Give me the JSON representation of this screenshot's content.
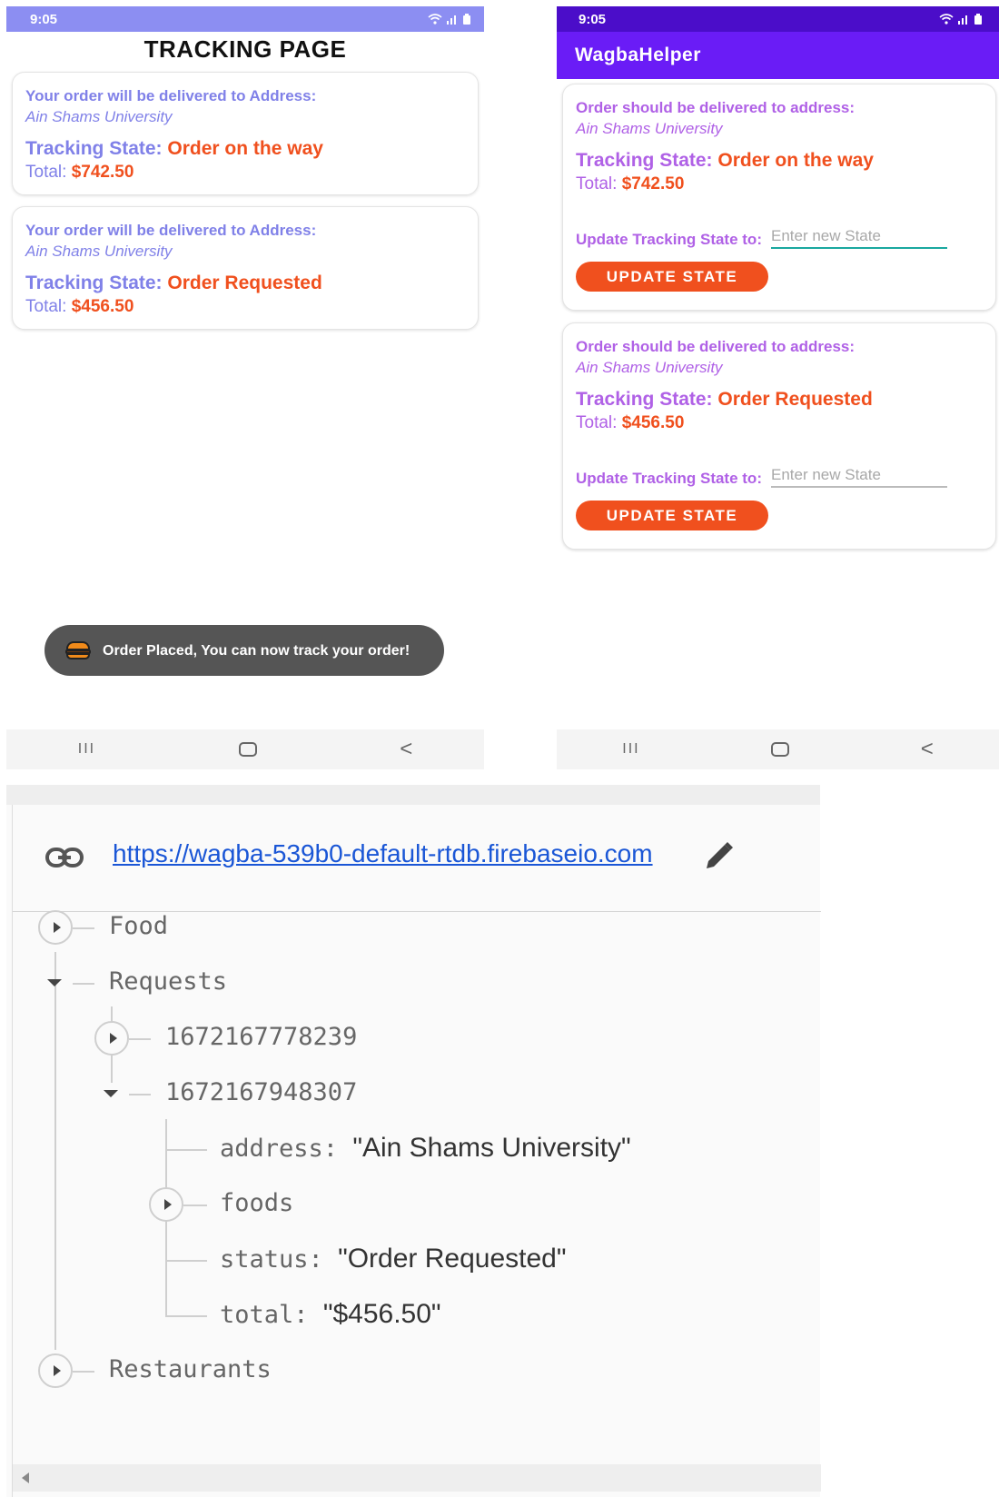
{
  "left_phone": {
    "status_time": "9:05",
    "status_icons": "wifi signal battery",
    "page_title": "TRACKING PAGE",
    "orders": [
      {
        "address_label": "Your order will be delivered to Address:",
        "address_value": "Ain Shams University",
        "state_label": "Tracking State:",
        "state_value": "Order on the way",
        "total_label": "Total:",
        "total_value": "$742.50"
      },
      {
        "address_label": "Your order will be delivered to Address:",
        "address_value": "Ain Shams University",
        "state_label": "Tracking State:",
        "state_value": "Order Requested",
        "total_label": "Total:",
        "total_value": "$456.50"
      }
    ],
    "toast_text": "Order Placed, You can now track your order!",
    "nav": {
      "recent": "III",
      "back": "<"
    }
  },
  "right_phone": {
    "status_time": "9:05",
    "app_title": "WagbaHelper",
    "orders": [
      {
        "address_label": "Order should be delivered to address:",
        "address_value": "Ain Shams University",
        "state_label": "Tracking State:",
        "state_value": "Order on the way",
        "total_label": "Total:",
        "total_value": "$742.50",
        "update_label": "Update Tracking State to:",
        "input_placeholder": "Enter new State",
        "button_label": "UPDATE STATE"
      },
      {
        "address_label": "Order should be delivered to address:",
        "address_value": "Ain Shams University",
        "state_label": "Tracking State:",
        "state_value": "Order Requested",
        "total_label": "Total:",
        "total_value": "$456.50",
        "update_label": "Update Tracking State to:",
        "input_placeholder": "Enter new State",
        "button_label": "UPDATE STATE"
      }
    ],
    "nav": {
      "recent": "III",
      "back": "<"
    }
  },
  "firebase": {
    "db_url": "https://wagba-539b0-default-rtdb.firebaseio.com",
    "tree": {
      "food": "Food",
      "requests": "Requests",
      "request_1": "1672167778239",
      "request_2": "1672167948307",
      "address_key": "address:",
      "address_val": "\"Ain Shams University\"",
      "foods_key": "foods",
      "status_key": "status:",
      "status_val": "\"Order Requested\"",
      "total_key": "total:",
      "total_val": "\"$456.50\"",
      "restaurants": "Restaurants"
    }
  },
  "colors": {
    "left_status_bar": "#8c8ef2",
    "left_text": "#8081e8",
    "accent_orange": "#f0501e",
    "right_status_bar": "#4b0dc9",
    "right_app_bar": "#6a1cf6",
    "right_text": "#b061e6",
    "link_blue": "#1a56d6"
  }
}
